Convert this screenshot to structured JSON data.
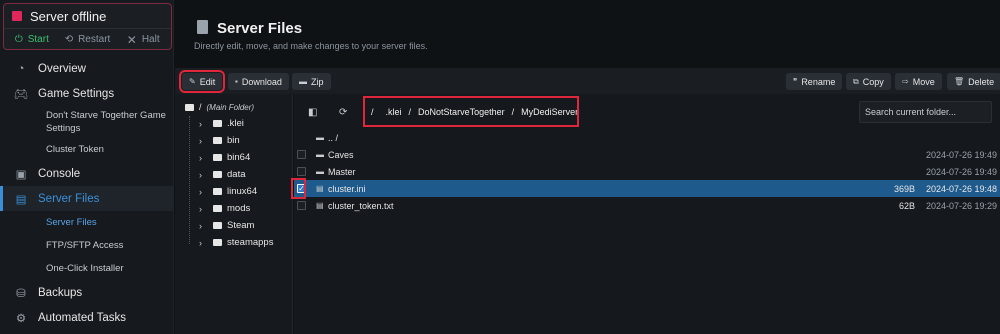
{
  "server": {
    "status": "Server offline",
    "start": "Start",
    "restart": "Restart",
    "halt": "Halt"
  },
  "nav": {
    "overview": "Overview",
    "game_settings": "Game Settings",
    "dst_settings": "Don't Starve Together Game Settings",
    "cluster_token": "Cluster Token",
    "console": "Console",
    "server_files": "Server Files",
    "server_files_sub": "Server Files",
    "ftp": "FTP/SFTP Access",
    "installer": "One-Click Installer",
    "backups": "Backups",
    "automated": "Automated Tasks"
  },
  "header": {
    "title": "Server Files",
    "subtitle": "Directly edit, move, and make changes to your server files."
  },
  "toolbar": {
    "edit": "Edit",
    "download": "Download",
    "zip": "Zip",
    "rename": "Rename",
    "copy": "Copy",
    "move": "Move",
    "delete": "Delete"
  },
  "tree": {
    "root": "/",
    "root_label": "(Main Folder)",
    "items": [
      ".klei",
      "bin",
      "bin64",
      "data",
      "linux64",
      "mods",
      "Steam",
      "steamapps"
    ]
  },
  "path": {
    "root": "/",
    "parts": [
      ".klei",
      "DoNotStarveTogether",
      "MyDediServer"
    ],
    "sep": "/"
  },
  "search": {
    "placeholder": "Search current folder..."
  },
  "files": [
    {
      "name": ".. /",
      "size": "",
      "date": ""
    },
    {
      "name": "Caves",
      "size": "",
      "date": "2024-07-26 19:49"
    },
    {
      "name": "Master",
      "size": "",
      "date": "2024-07-26 19:49"
    },
    {
      "name": "cluster.ini",
      "size": "369B",
      "date": "2024-07-26 19:48"
    },
    {
      "name": "cluster_token.txt",
      "size": "62B",
      "date": "2024-07-26 19:29"
    }
  ]
}
